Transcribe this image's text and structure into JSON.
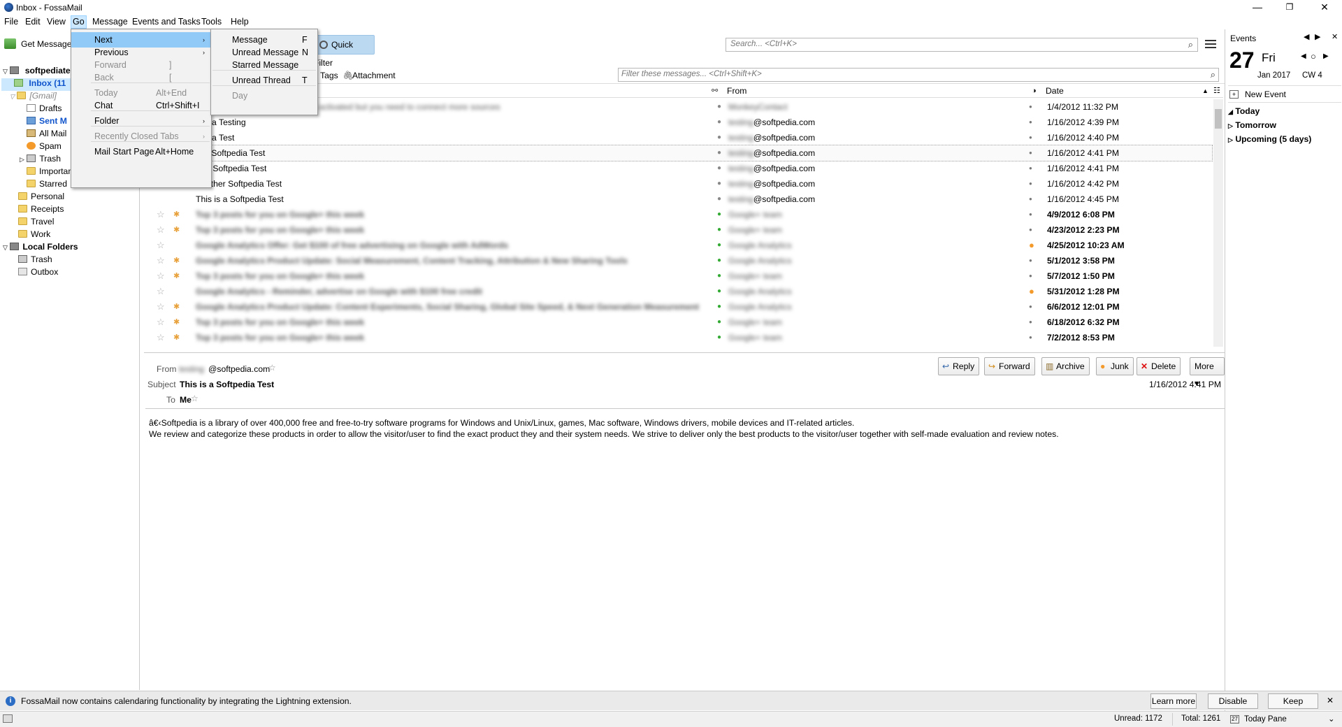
{
  "window": {
    "title": "Inbox - FossaMail"
  },
  "menubar": {
    "items": [
      "File",
      "Edit",
      "View",
      "Go",
      "Message",
      "Events and Tasks",
      "Tools",
      "Help"
    ]
  },
  "toolbar": {
    "get_messages": "Get Messages",
    "quick_filter": "Quick Filter",
    "search_placeholder": "Search... <Ctrl+K>",
    "filter_placeholder": "Filter these messages... <Ctrl+Shift+K>",
    "tags": "Tags",
    "attachment": "Attachment"
  },
  "folders": {
    "account": "softpediate",
    "inbox": "Inbox (11",
    "gmail": "[Gmail]",
    "items": [
      "Drafts",
      "Sent M",
      "All Mail",
      "Spam",
      "Trash",
      "Important",
      "Starred"
    ],
    "labels": [
      "Personal",
      "Receipts",
      "Travel",
      "Work"
    ],
    "local": "Local Folders",
    "local_items": [
      "Trash",
      "Outbox"
    ]
  },
  "go_menu": {
    "items": [
      {
        "label": "Next",
        "key": ""
      },
      {
        "label": "Previous",
        "key": ""
      },
      {
        "label": "Forward",
        "key": "]"
      },
      {
        "label": "Back",
        "key": "["
      },
      {
        "label": "Today",
        "key": "Alt+End"
      },
      {
        "label": "Chat",
        "key": "Ctrl+Shift+I"
      },
      {
        "label": "Folder",
        "key": ""
      },
      {
        "label": "Recently Closed Tabs",
        "key": ""
      },
      {
        "label": "Mail Start Page",
        "key": "Alt+Home"
      }
    ]
  },
  "next_submenu": {
    "items": [
      {
        "label": "Message",
        "key": "F"
      },
      {
        "label": "Unread Message",
        "key": "N"
      },
      {
        "label": "Starred Message",
        "key": ""
      },
      {
        "label": "Unread Thread",
        "key": "T"
      },
      {
        "label": "Day",
        "key": ""
      }
    ]
  },
  "columns": {
    "from": "From",
    "date": "Date"
  },
  "messages": [
    {
      "subject": "Contact: Your account has been activated but you need to connect more sources",
      "from": "MonkeyContact",
      "date": "1/4/2012 11:32 PM"
    },
    {
      "subject": "pedia Testing",
      "from": "@softpedia.com",
      "date": "1/16/2012 4:39 PM"
    },
    {
      "subject": "pedia Test",
      "from": "@softpedia.com",
      "date": "1/16/2012 4:40 PM"
    },
    {
      "subject": "is a Softpedia Test",
      "from": "@softpedia.com",
      "date": "1/16/2012 4:41 PM"
    },
    {
      "subject": "ther Softpedia Test",
      "from": "@softpedia.com",
      "date": "1/16/2012 4:41 PM"
    },
    {
      "subject": "Another Softpedia Test",
      "from": "@softpedia.com",
      "date": "1/16/2012 4:42 PM"
    },
    {
      "subject": "This is a Softpedia Test",
      "from": "@softpedia.com",
      "date": "1/16/2012 4:45 PM"
    },
    {
      "subject": "Top 3 posts for you on Google+ this week",
      "from": "Google+ team",
      "date": "4/9/2012 6:08 PM"
    },
    {
      "subject": "Top 3 posts for you on Google+ this week",
      "from": "Google+ team",
      "date": "4/23/2012 2:23 PM"
    },
    {
      "subject": "Google Analytics Offer: Get $100 of free advertising on Google with AdWords",
      "from": "Google Analytics",
      "date": "4/25/2012 10:23 AM"
    },
    {
      "subject": "Google Analytics Product Update: Social Measurement, Content Tracking, Attribution & New Sharing Tools",
      "from": "Google Analytics",
      "date": "5/1/2012 3:58 PM"
    },
    {
      "subject": "Top 3 posts for you on Google+ this week",
      "from": "Google+ team",
      "date": "5/7/2012 1:50 PM"
    },
    {
      "subject": "Google Analytics - Reminder, advertise on Google with $100 free credit",
      "from": "Google Analytics",
      "date": "5/31/2012 1:28 PM"
    },
    {
      "subject": "Google Analytics Product Update: Content Experiments, Social Sharing, Global Site Speed, & Next Generation Measurement",
      "from": "Google Analytics",
      "date": "6/6/2012 12:01 PM"
    },
    {
      "subject": "Top 3 posts for you on Google+ this week",
      "from": "Google+ team",
      "date": "6/18/2012 6:32 PM"
    },
    {
      "subject": "Top 3 posts for you on Google+ this week",
      "from": "Google+ team",
      "date": "7/2/2012 8:53 PM"
    }
  ],
  "preview": {
    "from_label": "From",
    "from_value": "@softpedia.com",
    "subject_label": "Subject",
    "subject_value": "This is a Softpedia Test",
    "to_label": "To",
    "to_value": "Me",
    "date": "1/16/2012 4:41 PM",
    "buttons": [
      "Reply",
      "Forward",
      "Archive",
      "Junk",
      "Delete",
      "More"
    ],
    "body_line1": "â€‹Softpedia is a library of over 400,000 free and free-to-try software programs for Windows and Unix/Linux, games, Mac software, Windows drivers, mobile devices and IT-related articles.",
    "body_line2": "We review and categorize these products in order to allow the visitor/user to find the exact product they and their system needs. We strive to deliver only the best products to the visitor/user together with self-made evaluation and review notes."
  },
  "today_pane": {
    "header": "Events",
    "day_num": "27",
    "day_name": "Fri",
    "month_year": "Jan 2017",
    "cw": "CW 4",
    "new_event": "New Event",
    "sections": [
      "Today",
      "Tomorrow",
      "Upcoming (5 days)"
    ]
  },
  "notification": {
    "text": "FossaMail now contains calendaring functionality by integrating the Lightning extension.",
    "learn_more": "Learn more",
    "disable": "Disable",
    "keep": "Keep"
  },
  "status": {
    "unread": "Unread: 1172",
    "total": "Total: 1261",
    "today_pane": "Today Pane"
  }
}
